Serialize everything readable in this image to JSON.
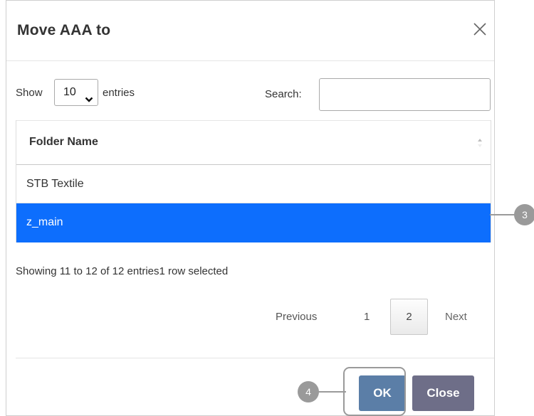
{
  "dialog": {
    "title": "Move AAA to"
  },
  "table_controls": {
    "show_label": "Show",
    "page_length": "10",
    "entries_label": "entries",
    "search_label": "Search:",
    "search_value": ""
  },
  "table": {
    "column_header": "Folder Name",
    "rows": [
      {
        "name": "STB Textile",
        "selected": false
      },
      {
        "name": "z_main",
        "selected": true
      }
    ]
  },
  "info_text": "Showing 11 to 12 of 12 entries1 row selected",
  "pagination": {
    "previous": "Previous",
    "page1": "1",
    "page2": "2",
    "next": "Next",
    "current_page": 2
  },
  "footer": {
    "ok_label": "OK",
    "close_label": "Close"
  },
  "callouts": {
    "row_callout": "3",
    "ok_callout": "4"
  },
  "colors": {
    "selected_row": "#0d6efd",
    "ok_button": "#5b7ea7",
    "close_button": "#6e6e88",
    "callout": "#9a9a9a"
  },
  "icons": {
    "close": "close-icon",
    "dropdown": "chevron-down-icon",
    "sort": "sort-icon"
  }
}
